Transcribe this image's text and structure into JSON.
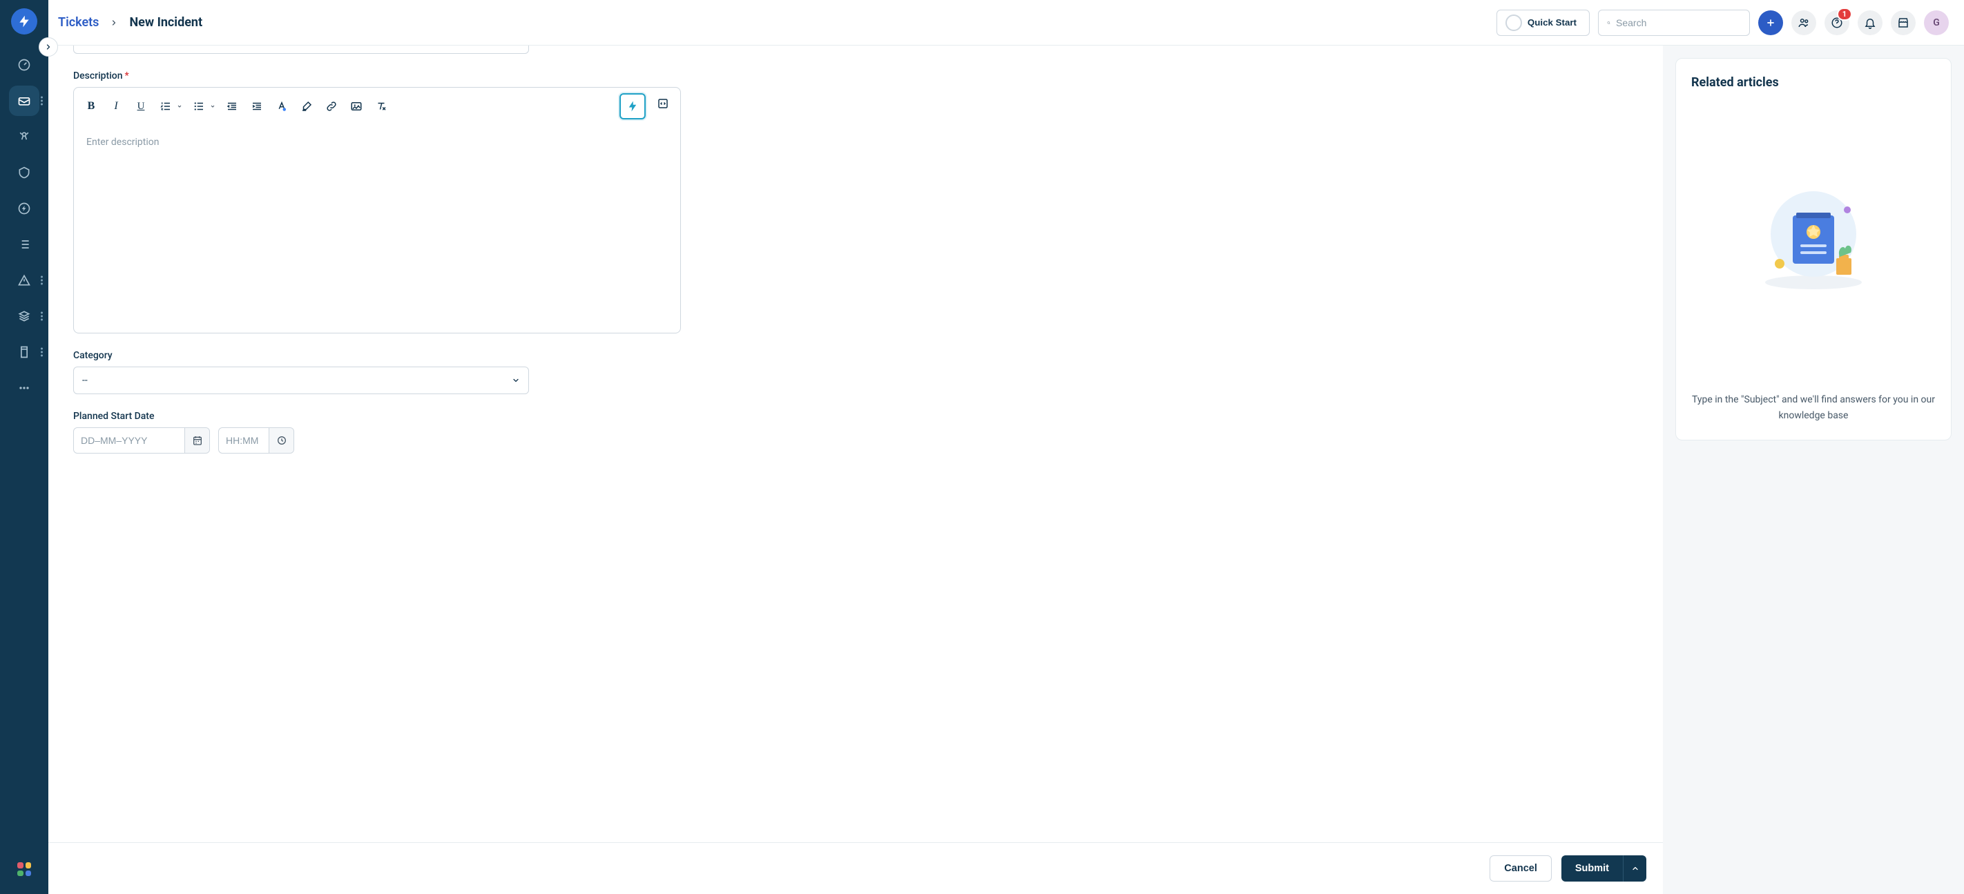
{
  "breadcrumb": {
    "root_label": "Tickets",
    "current_label": "New Incident"
  },
  "topbar": {
    "quick_start_label": "Quick Start",
    "search_placeholder": "Search",
    "notification_badge": "1",
    "avatar_initial": "G"
  },
  "form": {
    "description_label": "Description",
    "description_placeholder": "Enter description",
    "category_label": "Category",
    "category_value": "--",
    "planned_start_label": "Planned Start Date",
    "date_placeholder": "DD–MM–YYYY",
    "time_placeholder": "HH:MM"
  },
  "right_panel": {
    "title": "Related articles",
    "empty_text": "Type in the \"Subject\" and we'll find answers for you in our knowledge base"
  },
  "footer": {
    "cancel_label": "Cancel",
    "submit_label": "Submit"
  }
}
